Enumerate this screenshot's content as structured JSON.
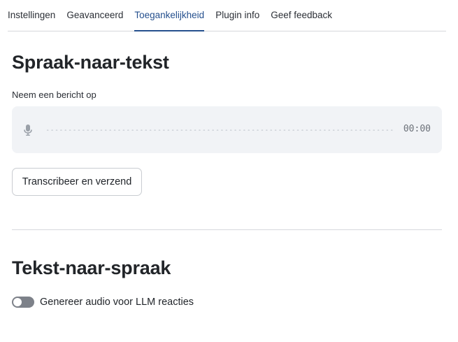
{
  "tabs": [
    {
      "label": "Instellingen",
      "active": false
    },
    {
      "label": "Geavanceerd",
      "active": false
    },
    {
      "label": "Toegankelijkheid",
      "active": true
    },
    {
      "label": "Plugin info",
      "active": false
    },
    {
      "label": "Geef feedback",
      "active": false
    }
  ],
  "accent_color": "#25508e",
  "speech_to_text": {
    "title": "Spraak-naar-tekst",
    "record_label": "Neem een bericht op",
    "mic_icon": "microphone-icon",
    "timer": "00:00",
    "transcribe_button": "Transcribeer en verzend"
  },
  "text_to_speech": {
    "title": "Tekst-naar-spraak",
    "toggle_label": "Genereer audio voor LLM reacties",
    "toggle_on": false
  }
}
